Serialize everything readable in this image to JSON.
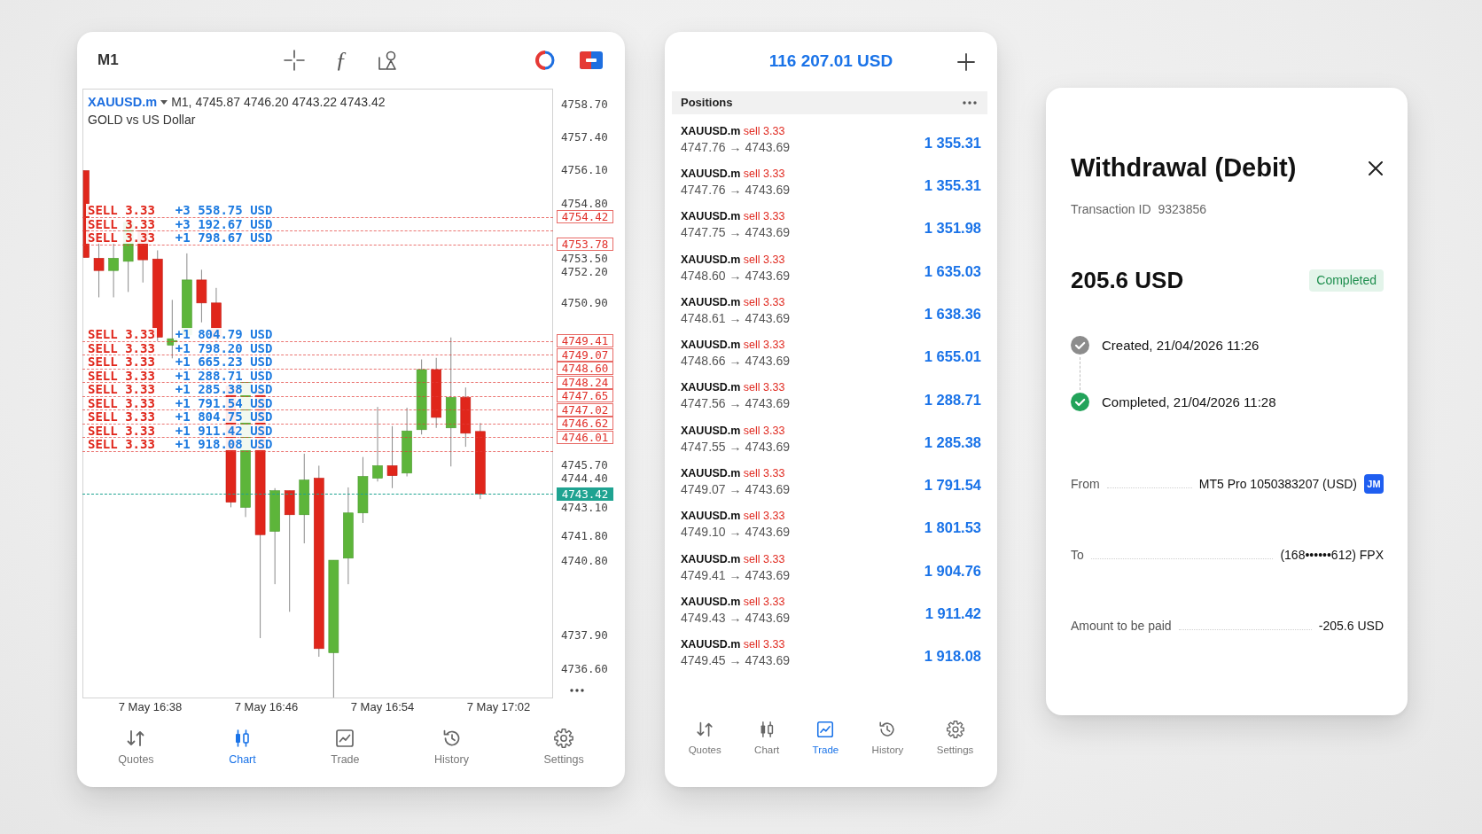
{
  "chart_app": {
    "toolbar": {
      "timeframe": "M1",
      "function_glyph": "ƒ"
    },
    "chart": {
      "symbol": "XAUUSD.m",
      "ohlc": "M1, 4745.87 4746.20 4743.22 4743.42",
      "description": "GOLD vs US Dollar",
      "price_ticks": [
        "4758.70",
        "4757.40",
        "4756.10",
        "4754.80",
        "4753.50",
        "4752.20",
        "4750.90",
        "4745.70",
        "4744.40",
        "4743.10",
        "4741.80",
        "4740.80",
        "4737.90",
        "4736.60"
      ],
      "order_lines": [
        {
          "side": "SELL",
          "volume": "3.33",
          "profit": "+3 558.75 USD",
          "price": "4754.42"
        },
        {
          "side": "SELL",
          "volume": "3.33",
          "profit": "+3 192.67 USD"
        },
        {
          "side": "SELL",
          "volume": "3.33",
          "profit": "+1 798.67 USD",
          "price": "4753.78"
        },
        {
          "side": "SELL",
          "volume": "3.33",
          "profit": "+1 804.79 USD",
          "price": "4749.41"
        },
        {
          "side": "SELL",
          "volume": "3.33",
          "profit": "+1 798.20 USD",
          "price": "4749.07"
        },
        {
          "side": "SELL",
          "volume": "3.33",
          "profit": "+1 665.23 USD",
          "price": "4748.60"
        },
        {
          "side": "SELL",
          "volume": "3.33",
          "profit": "+1 288.71 USD",
          "price": "4748.24"
        },
        {
          "side": "SELL",
          "volume": "3.33",
          "profit": "+1 285.38 USD",
          "price": "4747.65"
        },
        {
          "side": "SELL",
          "volume": "3.33",
          "profit": "+1 791.54 USD",
          "price": "4747.02"
        },
        {
          "side": "SELL",
          "volume": "3.33",
          "profit": "+1 804.75 USD",
          "price": "4746.62"
        },
        {
          "side": "SELL",
          "volume": "3.33",
          "profit": "+1 911.42 USD",
          "price": "4746.01"
        },
        {
          "side": "SELL",
          "volume": "3.33",
          "profit": "+1 918.08 USD"
        }
      ],
      "current_price": "4743.42",
      "time_ticks": [
        "7 May 16:38",
        "7 May 16:46",
        "7 May 16:54",
        "7 May 17:02"
      ]
    },
    "nav": [
      {
        "label": "Quotes",
        "selected": false
      },
      {
        "label": "Chart",
        "selected": true
      },
      {
        "label": "Trade",
        "selected": false
      },
      {
        "label": "History",
        "selected": false
      },
      {
        "label": "Settings",
        "selected": false
      }
    ]
  },
  "trade_app": {
    "balance": "116 207.01 USD",
    "section_title": "Positions",
    "positions": [
      {
        "symbol": "XAUUSD.m",
        "side": "sell",
        "volume": "3.33",
        "prices": "4747.76 → 4743.69",
        "profit": "1 355.31"
      },
      {
        "symbol": "XAUUSD.m",
        "side": "sell",
        "volume": "3.33",
        "prices": "4747.76 → 4743.69",
        "profit": "1 355.31"
      },
      {
        "symbol": "XAUUSD.m",
        "side": "sell",
        "volume": "3.33",
        "prices": "4747.75 → 4743.69",
        "profit": "1 351.98"
      },
      {
        "symbol": "XAUUSD.m",
        "side": "sell",
        "volume": "3.33",
        "prices": "4748.60 → 4743.69",
        "profit": "1 635.03"
      },
      {
        "symbol": "XAUUSD.m",
        "side": "sell",
        "volume": "3.33",
        "prices": "4748.61 → 4743.69",
        "profit": "1 638.36"
      },
      {
        "symbol": "XAUUSD.m",
        "side": "sell",
        "volume": "3.33",
        "prices": "4748.66 → 4743.69",
        "profit": "1 655.01"
      },
      {
        "symbol": "XAUUSD.m",
        "side": "sell",
        "volume": "3.33",
        "prices": "4747.56 → 4743.69",
        "profit": "1 288.71"
      },
      {
        "symbol": "XAUUSD.m",
        "side": "sell",
        "volume": "3.33",
        "prices": "4747.55 → 4743.69",
        "profit": "1 285.38"
      },
      {
        "symbol": "XAUUSD.m",
        "side": "sell",
        "volume": "3.33",
        "prices": "4749.07 → 4743.69",
        "profit": "1 791.54"
      },
      {
        "symbol": "XAUUSD.m",
        "side": "sell",
        "volume": "3.33",
        "prices": "4749.10 → 4743.69",
        "profit": "1 801.53"
      },
      {
        "symbol": "XAUUSD.m",
        "side": "sell",
        "volume": "3.33",
        "prices": "4749.41 → 4743.69",
        "profit": "1 904.76"
      },
      {
        "symbol": "XAUUSD.m",
        "side": "sell",
        "volume": "3.33",
        "prices": "4749.43 → 4743.69",
        "profit": "1 911.42"
      },
      {
        "symbol": "XAUUSD.m",
        "side": "sell",
        "volume": "3.33",
        "prices": "4749.45 → 4743.69",
        "profit": "1 918.08"
      }
    ],
    "nav": [
      {
        "label": "Quotes",
        "selected": false
      },
      {
        "label": "Chart",
        "selected": false
      },
      {
        "label": "Trade",
        "selected": true
      },
      {
        "label": "History",
        "selected": false
      },
      {
        "label": "Settings",
        "selected": false
      }
    ]
  },
  "withdrawal": {
    "title": "Withdrawal (Debit)",
    "transaction_label": "Transaction ID",
    "transaction_id": "9323856",
    "amount": "205.6 USD",
    "status": "Completed",
    "timeline": [
      {
        "text": "Created, 21/04/2026 11:26",
        "color": "#8c8c8c"
      },
      {
        "text": "Completed, 21/04/2026 11:28",
        "color": "#22a35a"
      }
    ],
    "details": [
      {
        "label": "From",
        "value": "MT5 Pro 1050383207 (USD)",
        "badge": "JM"
      },
      {
        "label": "To",
        "value": "(168••••••612) FPX"
      },
      {
        "label": "Amount to be paid",
        "value": "-205.6 USD"
      }
    ]
  }
}
